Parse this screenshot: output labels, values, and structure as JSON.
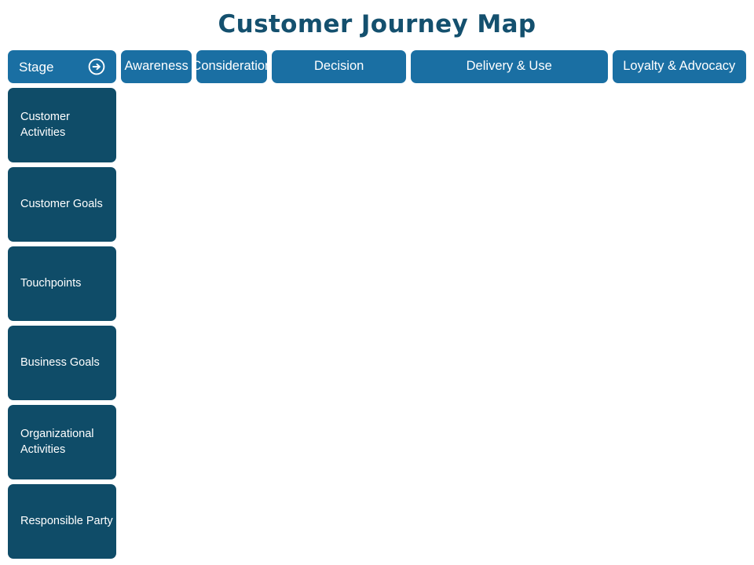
{
  "title": "Customer Journey Map",
  "colors": {
    "title": "#14506E",
    "header": "#1A6FA3",
    "row_label": "#0F4C68",
    "cell": "#EDF6FA",
    "text_on_blue": "#FFFFFF",
    "page_background": "#FFFFFF"
  },
  "header": {
    "stage_label": "Stage",
    "stage_icon": "arrow-right-circle-icon",
    "stages": [
      {
        "label": "Awareness",
        "span": 1
      },
      {
        "label": "Consideration",
        "span": 1
      },
      {
        "label": "Decision",
        "span": 2
      },
      {
        "label": "Delivery & Use",
        "span": 3
      },
      {
        "label": "Loyalty & Advocacy",
        "span": 2
      }
    ]
  },
  "rows": [
    {
      "label": "Customer Activities",
      "cells": [
        "",
        "",
        "",
        "",
        "",
        "",
        "",
        "",
        ""
      ]
    },
    {
      "label": "Customer Goals",
      "cells": [
        "",
        "",
        "",
        "",
        "",
        "",
        "",
        "",
        ""
      ]
    },
    {
      "label": "Touchpoints",
      "cells": [
        "",
        "",
        "",
        "",
        "",
        "",
        "",
        "",
        ""
      ]
    },
    {
      "label": "Business Goals",
      "cells": [
        "",
        "",
        "",
        "",
        "",
        "",
        "",
        "",
        ""
      ]
    },
    {
      "label": "Organizational Activities",
      "cells": [
        "",
        "",
        "",
        "",
        "",
        "",
        "",
        "",
        ""
      ]
    },
    {
      "label": "Responsible Party",
      "cells": [
        "",
        "",
        "",
        "",
        "",
        "",
        "",
        "",
        ""
      ]
    }
  ],
  "grid": {
    "total_columns": 9,
    "total_rows": 6
  }
}
